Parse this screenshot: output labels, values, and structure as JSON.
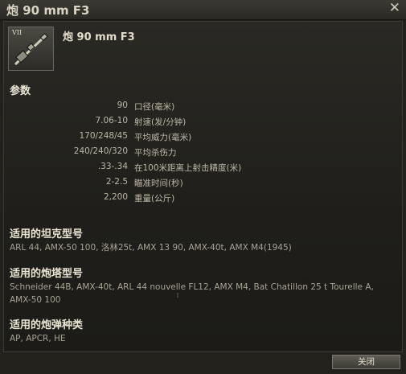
{
  "window": {
    "title": "炮 90 mm F3",
    "close_glyph": "✕"
  },
  "header": {
    "tier": "VII",
    "gun_name": "炮 90 mm F3",
    "icon": "gun-icon"
  },
  "params": {
    "heading": "参数",
    "rows": [
      {
        "value": "90",
        "label": "口径(毫米)"
      },
      {
        "value": "7.06-10",
        "label": "射速(发/分钟)"
      },
      {
        "value": "170/248/45",
        "label": "平均威力(毫米)"
      },
      {
        "value": "240/240/320",
        "label": "平均杀伤力"
      },
      {
        "value": ".33-.34",
        "label": "在100米距离上射击精度(米)"
      },
      {
        "value": "2-2.5",
        "label": "瞄准时间(秒)"
      },
      {
        "value": "2,200",
        "label": "重量(公斤)"
      }
    ]
  },
  "tanks": {
    "heading": "适用的坦克型号",
    "text": "ARL 44, AMX-50 100, 洛林25t, AMX 13 90, AMX-40t, AMX M4(1945)"
  },
  "turrets": {
    "heading": "适用的炮塔型号",
    "text": "Schneider 44B, AMX-40t, ARL 44 nouvelle FL12, AMX M4, Bat Chatillon 25 t Tourelle A, AMX-50 100"
  },
  "shells": {
    "heading": "适用的炮弹种类",
    "text": "AP, APCR, HE"
  },
  "footer": {
    "close_label": "关闭"
  }
}
